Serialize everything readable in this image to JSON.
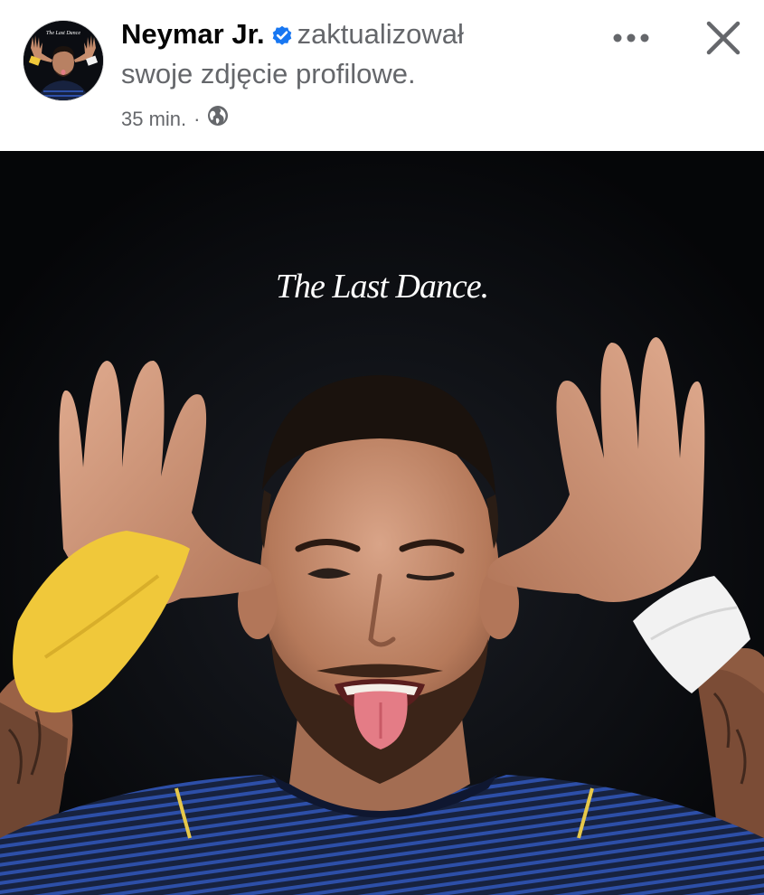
{
  "post": {
    "author": "Neymar Jr.",
    "action_text": "zaktualizował",
    "action_text_line2": "swoje zdjęcie profilowe.",
    "time": "35 min.",
    "separator": "·",
    "audience_icon": "globe-icon",
    "verified_icon": "verified-badge-icon"
  },
  "avatar": {
    "caption": "The Last Dance"
  },
  "photo": {
    "caption": "The Last Dance."
  },
  "controls": {
    "more_icon": "more-options-icon",
    "close_icon": "close-icon"
  },
  "colors": {
    "name": "#050505",
    "secondary_text": "#65676b",
    "verified_blue": "#1877f2",
    "photo_background": "#07080b",
    "jersey_navy": "#17223f",
    "jersey_stripe": "#2d4fa8",
    "wrist_tape_yellow": "#f0c83a",
    "wrist_tape_white": "#f2f2f2"
  }
}
